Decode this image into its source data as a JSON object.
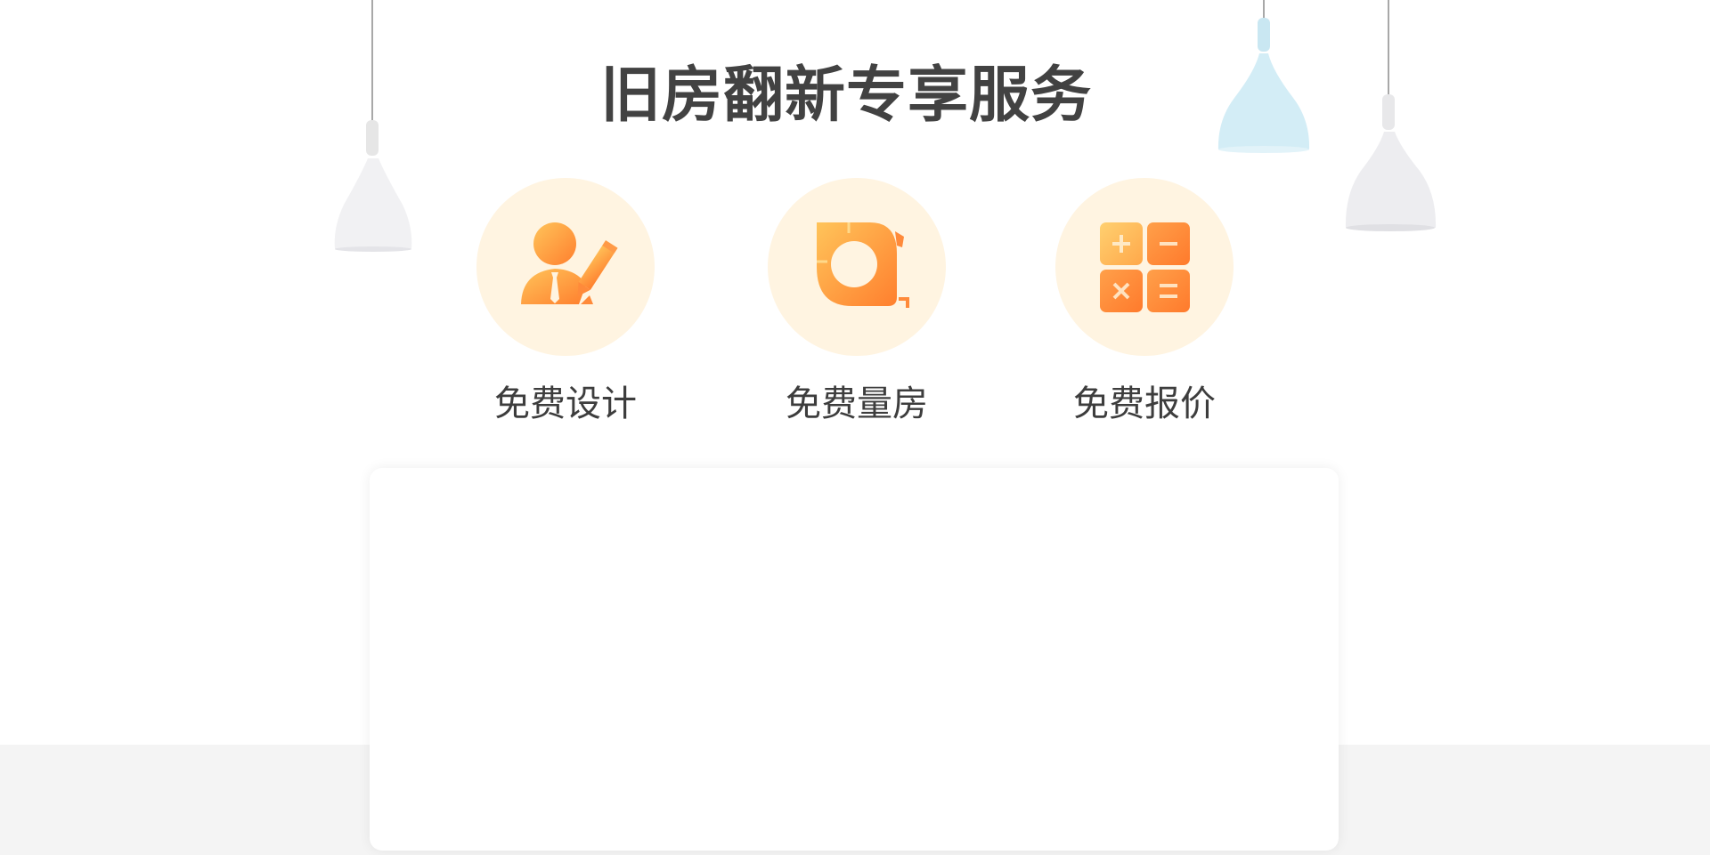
{
  "page": {
    "title": "旧房翻新专享服务"
  },
  "services": [
    {
      "label": "免费设计",
      "icon": "designer-pencil-icon"
    },
    {
      "label": "免费量房",
      "icon": "tape-measure-icon"
    },
    {
      "label": "免费报价",
      "icon": "calculator-icon"
    }
  ],
  "colors": {
    "accent_orange": "#ff8a3a",
    "accent_yellow": "#ffc45a",
    "circle_bg": "#fff4e1",
    "title_text": "#424242",
    "floor": "#f4f4f4"
  }
}
